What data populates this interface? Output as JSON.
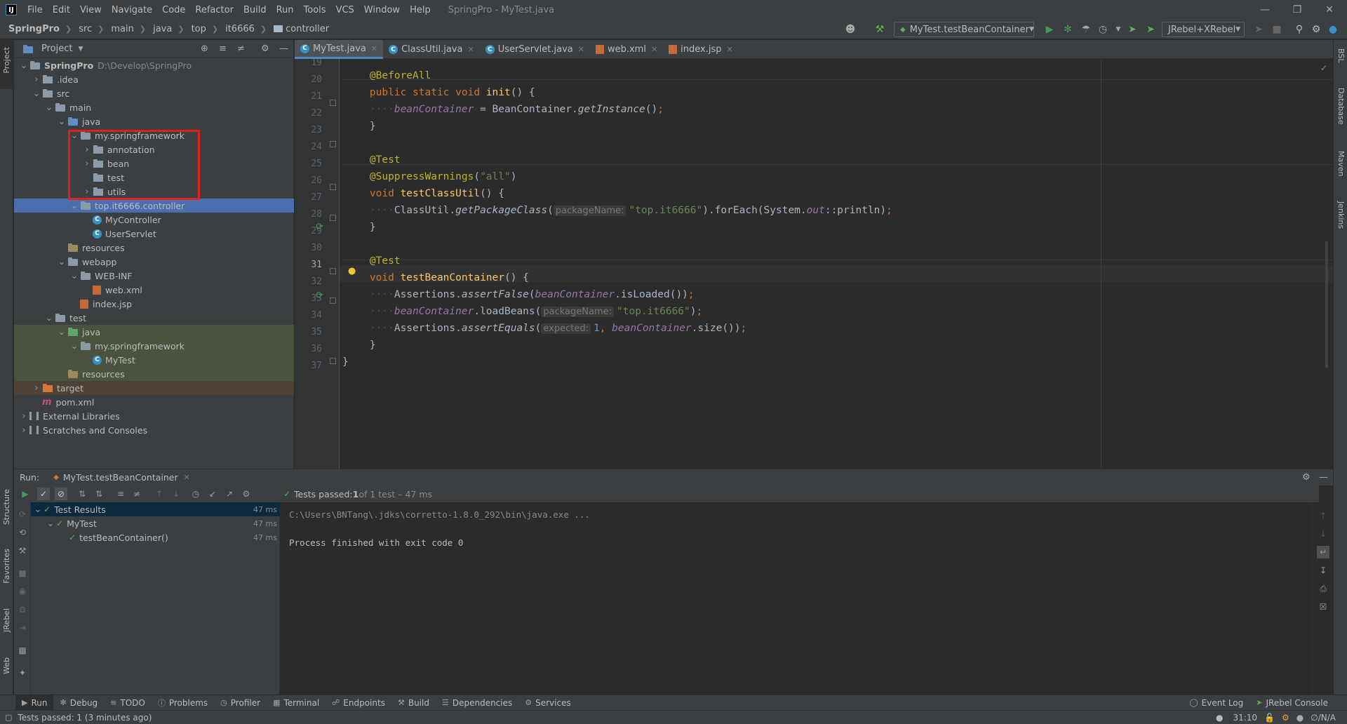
{
  "menubar": {
    "logo": "IJ",
    "items": [
      "File",
      "Edit",
      "View",
      "Navigate",
      "Code",
      "Refactor",
      "Build",
      "Run",
      "Tools",
      "VCS",
      "Window",
      "Help"
    ],
    "title": "SpringPro - MyTest.java"
  },
  "navbar": {
    "crumbs": [
      "SpringPro",
      "src",
      "main",
      "java",
      "top",
      "it6666",
      "controller"
    ],
    "run_config": "MyTest.testBeanContainer",
    "jrebel_combo": "JRebel+XRebel"
  },
  "left_strip": {
    "project": "Project",
    "structure": "Structure",
    "favorites": "Favorites",
    "jrebel": "JRebel",
    "web": "Web"
  },
  "right_strip": {
    "bsl": "BSL",
    "database": "Database",
    "maven": "Maven",
    "jenkins": "Jenkins"
  },
  "project": {
    "header": "Project",
    "tree": [
      {
        "label": "SpringPro",
        "extra": "D:\\Develop\\SpringPro",
        "indent": 0,
        "arrow": "down",
        "icon": "folder",
        "bold": true
      },
      {
        "label": ".idea",
        "indent": 1,
        "arrow": "right",
        "icon": "folder"
      },
      {
        "label": "src",
        "indent": 1,
        "arrow": "down",
        "icon": "folder"
      },
      {
        "label": "main",
        "indent": 2,
        "arrow": "down",
        "icon": "folder"
      },
      {
        "label": "java",
        "indent": 3,
        "arrow": "down",
        "icon": "src"
      },
      {
        "label": "my.springframework",
        "indent": 4,
        "arrow": "down",
        "icon": "folder"
      },
      {
        "label": "annotation",
        "indent": 5,
        "arrow": "right",
        "icon": "folder"
      },
      {
        "label": "bean",
        "indent": 5,
        "arrow": "right",
        "icon": "folder"
      },
      {
        "label": "test",
        "indent": 5,
        "arrow": "none",
        "icon": "folder"
      },
      {
        "label": "utils",
        "indent": 5,
        "arrow": "right",
        "icon": "folder"
      },
      {
        "label": "top.it6666.controller",
        "indent": 4,
        "arrow": "down",
        "icon": "folder",
        "state": "selected"
      },
      {
        "label": "MyController",
        "indent": 5,
        "arrow": "none",
        "icon": "class"
      },
      {
        "label": "UserServlet",
        "indent": 5,
        "arrow": "none",
        "icon": "class"
      },
      {
        "label": "resources",
        "indent": 3,
        "arrow": "none",
        "icon": "res"
      },
      {
        "label": "webapp",
        "indent": 3,
        "arrow": "down",
        "icon": "folder"
      },
      {
        "label": "WEB-INF",
        "indent": 4,
        "arrow": "down",
        "icon": "folder"
      },
      {
        "label": "web.xml",
        "indent": 5,
        "arrow": "none",
        "icon": "xml"
      },
      {
        "label": "index.jsp",
        "indent": 4,
        "arrow": "none",
        "icon": "xml"
      },
      {
        "label": "test",
        "indent": 2,
        "arrow": "down",
        "icon": "folder"
      },
      {
        "label": "java",
        "indent": 3,
        "arrow": "down",
        "icon": "tst",
        "state": "test"
      },
      {
        "label": "my.springframework",
        "indent": 4,
        "arrow": "down",
        "icon": "folder",
        "state": "test"
      },
      {
        "label": "MyTest",
        "indent": 5,
        "arrow": "none",
        "icon": "class",
        "state": "test"
      },
      {
        "label": "resources",
        "indent": 3,
        "arrow": "none",
        "icon": "res",
        "state": "test"
      },
      {
        "label": "target",
        "indent": 1,
        "arrow": "right",
        "icon": "tgt",
        "state": "excluded"
      },
      {
        "label": "pom.xml",
        "indent": 1,
        "arrow": "none",
        "icon": "maven"
      },
      {
        "label": "External Libraries",
        "indent": 0,
        "arrow": "right",
        "icon": "lib"
      },
      {
        "label": "Scratches and Consoles",
        "indent": 0,
        "arrow": "right",
        "icon": "lib"
      }
    ]
  },
  "tabs": [
    {
      "label": "MyTest.java",
      "active": true,
      "icon": "class"
    },
    {
      "label": "ClassUtil.java",
      "icon": "class"
    },
    {
      "label": "UserServlet.java",
      "icon": "class"
    },
    {
      "label": "web.xml",
      "icon": "xml"
    },
    {
      "label": "index.jsp",
      "icon": "xml"
    }
  ],
  "editor": {
    "line_numbers": [
      "19",
      "20",
      "21",
      "22",
      "23",
      "24",
      "25",
      "26",
      "27",
      "28",
      "29",
      "30",
      "31",
      "32",
      "33",
      "34",
      "35",
      "36",
      "37"
    ],
    "current_line": "31"
  },
  "run": {
    "label": "Run:",
    "tab": "MyTest.testBeanContainer",
    "summary_prefix": "Tests passed: ",
    "summary_count": "1",
    "summary_suffix": " of 1 test – 47 ms",
    "tree": [
      {
        "label": "Test Results",
        "time": "47 ms",
        "indent": 0
      },
      {
        "label": "MyTest",
        "time": "47 ms",
        "indent": 1
      },
      {
        "label": "testBeanContainer()",
        "time": "47 ms",
        "indent": 2
      }
    ],
    "console_cmd": "C:\\Users\\BNTang\\.jdks\\corretto-1.8.0_292\\bin\\java.exe ...",
    "console_exit": "Process finished with exit code 0"
  },
  "bottom_tools": [
    "Run",
    "Debug",
    "TODO",
    "Problems",
    "Profiler",
    "Terminal",
    "Endpoints",
    "Build",
    "Dependencies",
    "Services"
  ],
  "bottom_right": {
    "event_log": "Event Log",
    "jrebel_console": "JRebel Console"
  },
  "status": {
    "message": "Tests passed: 1 (3 minutes ago)",
    "position": "31:10",
    "encoding": "∅/N/A"
  }
}
